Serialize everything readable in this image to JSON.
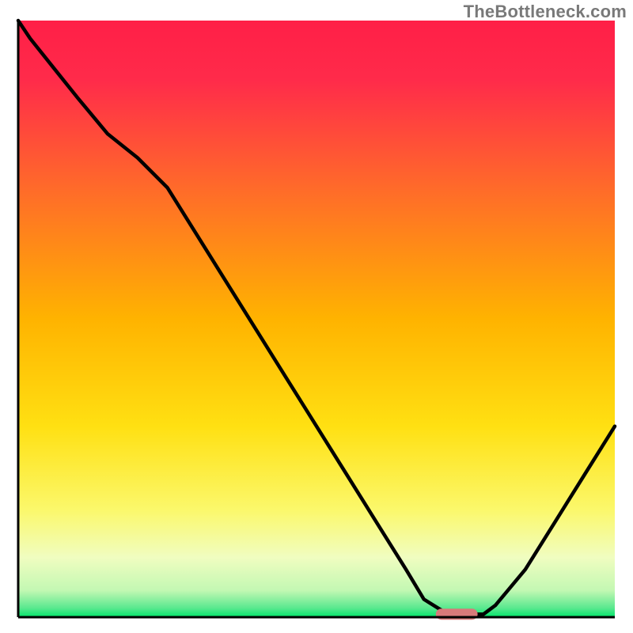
{
  "watermark": "TheBottleneck.com",
  "colors": {
    "gradient_top": "#ff1f47",
    "gradient_mid1": "#fd7e14",
    "gradient_mid2": "#ffd400",
    "gradient_mid3": "#f5fdb3",
    "gradient_bottom": "#00e56a",
    "curve": "#000000",
    "marker": "#d87a7a",
    "axis": "#000000"
  },
  "chart_data": {
    "type": "line",
    "title": "",
    "xlabel": "",
    "ylabel": "",
    "xlim": [
      0,
      100
    ],
    "ylim": [
      0,
      100
    ],
    "grid": false,
    "legend": false,
    "comment": "Values in percent. x is horizontal position across the plot, y is vertical position where 0=bottom/green and 100=top/red. Curve depicts bottleneck severity; the salmon pill marks the flat minimum region.",
    "series": [
      {
        "name": "bottleneck-curve",
        "x": [
          0,
          2,
          6,
          10,
          15,
          20,
          25,
          30,
          35,
          40,
          45,
          50,
          55,
          60,
          65,
          68,
          72,
          75,
          78,
          80,
          85,
          90,
          95,
          100
        ],
        "y": [
          100,
          97,
          92,
          87,
          81,
          77,
          72,
          64,
          56,
          48,
          40,
          32,
          24,
          16,
          8,
          3,
          0.5,
          0.5,
          0.5,
          2,
          8,
          16,
          24,
          32
        ]
      }
    ],
    "marker": {
      "name": "optimal-range",
      "x_start": 70,
      "x_end": 77,
      "y": 0.5
    }
  }
}
